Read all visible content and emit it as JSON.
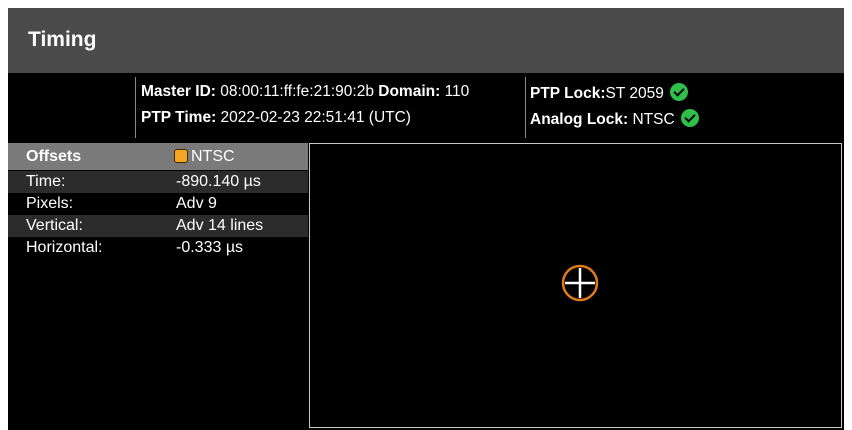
{
  "window": {
    "title": "Timing"
  },
  "ptp": {
    "master_id_label": "Master ID:",
    "master_id": "08:00:11:ff:fe:21:90:2b",
    "domain_label": "Domain:",
    "domain": "110",
    "time_label": "PTP Time:",
    "time": "2022-02-23 22:51:41 (UTC)"
  },
  "lock": {
    "ptp_lock_label": "PTP Lock:",
    "ptp_lock_value": "ST 2059",
    "ptp_lock_icon": "check-circle-icon",
    "analog_lock_label": "Analog Lock:",
    "analog_lock_value": "NTSC",
    "analog_lock_icon": "check-circle-icon",
    "ok_color": "#2ec04a"
  },
  "offsets": {
    "header": "Offsets",
    "standard": "NTSC",
    "standard_color": "#f5a623",
    "rows": [
      {
        "label": "Time:",
        "value": "-890.140 µs"
      },
      {
        "label": "Pixels:",
        "value": "Adv 9"
      },
      {
        "label": "Vertical:",
        "value": "Adv 14 lines"
      },
      {
        "label": "Horizontal:",
        "value": "-0.333 µs"
      }
    ]
  },
  "display": {
    "marker_icon": "crosshair-target-icon",
    "marker_color": "#e07b1a"
  }
}
